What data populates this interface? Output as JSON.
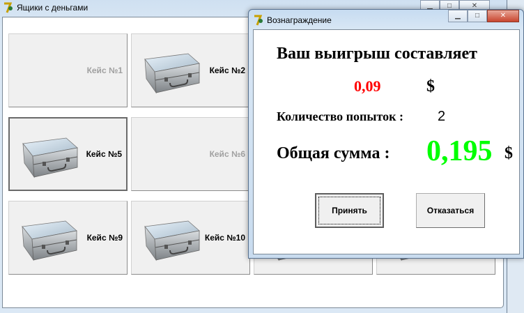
{
  "main_window": {
    "title": "Ящики с деньгами",
    "app_icon": "delphi-icon",
    "cases": [
      {
        "label": "Кейс №1",
        "state": "opened"
      },
      {
        "label": "Кейс №2",
        "state": "closed"
      },
      {
        "label": "",
        "state": "hidden"
      },
      {
        "label": "",
        "state": "hidden"
      },
      {
        "label": "Кейс №5",
        "state": "selected"
      },
      {
        "label": "Кейс №6",
        "state": "opened"
      },
      {
        "label": "",
        "state": "hidden"
      },
      {
        "label": "",
        "state": "hidden"
      },
      {
        "label": "Кейс №9",
        "state": "closed"
      },
      {
        "label": "Кейс №10",
        "state": "closed"
      },
      {
        "label": "",
        "state": "hidden"
      },
      {
        "label": "",
        "state": "hidden"
      }
    ]
  },
  "dialog": {
    "title": "Вознаграждение",
    "win_heading": "Ваш выигрыш составляет",
    "win_amount": "0,09",
    "currency": "$",
    "attempts_label": "Количество попыток :",
    "attempts_value": "2",
    "total_label": "Общая сумма :",
    "total_value": "0,195",
    "accept_label": "Принять",
    "decline_label": "Отказаться",
    "colors": {
      "win": "#ff0000",
      "total": "#00ff00"
    }
  }
}
